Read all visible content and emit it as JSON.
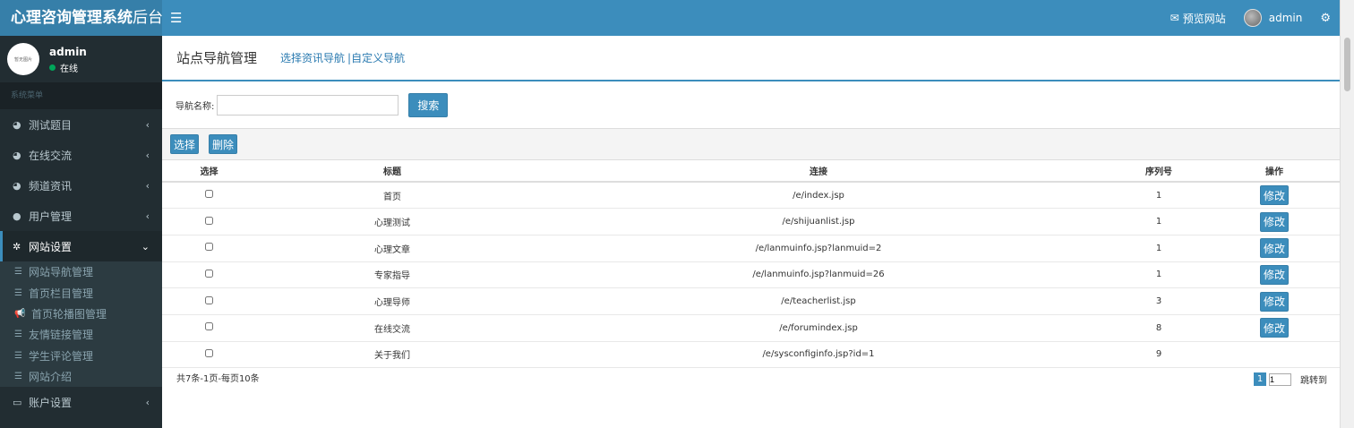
{
  "app": {
    "title_bold": "心理咨询管理系统",
    "title_light": "后台"
  },
  "topbar": {
    "menu_icon": "bars-icon",
    "preview_label": "预览网站",
    "user_name": "admin"
  },
  "sidebar": {
    "avatar_text": "暂无图片",
    "user_name": "admin",
    "status": "在线",
    "header": "系统菜单",
    "items": [
      {
        "label": "测试题目",
        "icon": "pie-chart-icon"
      },
      {
        "label": "在线交流",
        "icon": "pie-chart-icon"
      },
      {
        "label": "频道资讯",
        "icon": "pie-chart-icon"
      },
      {
        "label": "用户管理",
        "icon": "user-icon"
      },
      {
        "label": "网站设置",
        "icon": "gear-icon"
      },
      {
        "label": "账户设置",
        "icon": "laptop-icon"
      }
    ],
    "submenu": [
      {
        "label": "网站导航管理",
        "icon": "list-icon"
      },
      {
        "label": "首页栏目管理",
        "icon": "list-icon"
      },
      {
        "label": "首页轮播图管理",
        "icon": "bullhorn-icon"
      },
      {
        "label": "友情链接管理",
        "icon": "list-icon"
      },
      {
        "label": "学生评论管理",
        "icon": "list-icon"
      },
      {
        "label": "网站介绍",
        "icon": "list-icon"
      }
    ]
  },
  "content": {
    "page_title": "站点导航管理",
    "link_select": "选择资讯导航",
    "link_custom": "|自定义导航",
    "search_label": "导航名称:",
    "search_value": "",
    "search_button": "搜索",
    "select_button": "选择",
    "delete_button": "删除",
    "columns": [
      "选择",
      "标题",
      "连接",
      "序列号",
      "操作"
    ],
    "rows": [
      {
        "title": "首页",
        "link": "/e/index.jsp",
        "seq": "1",
        "action": "修改"
      },
      {
        "title": "心理测试",
        "link": "/e/shijuanlist.jsp",
        "seq": "1",
        "action": "修改"
      },
      {
        "title": "心理文章",
        "link": "/e/lanmuinfo.jsp?lanmuid=2",
        "seq": "1",
        "action": "修改"
      },
      {
        "title": "专家指导",
        "link": "/e/lanmuinfo.jsp?lanmuid=26",
        "seq": "1",
        "action": "修改"
      },
      {
        "title": "心理导师",
        "link": "/e/teacherlist.jsp",
        "seq": "3",
        "action": "修改"
      },
      {
        "title": "在线交流",
        "link": "/e/forumindex.jsp",
        "seq": "8",
        "action": "修改"
      },
      {
        "title": "关于我们",
        "link": "/e/sysconfiginfo.jsp?id=1",
        "seq": "9",
        "action": ""
      }
    ],
    "footer_info": "共7条-1页-每页10条",
    "pager_current": "1",
    "pager_input": "1",
    "pager_jump": "跳转到"
  },
  "colors": {
    "primary": "#3c8dbc",
    "sidebar_bg": "#222d32"
  }
}
